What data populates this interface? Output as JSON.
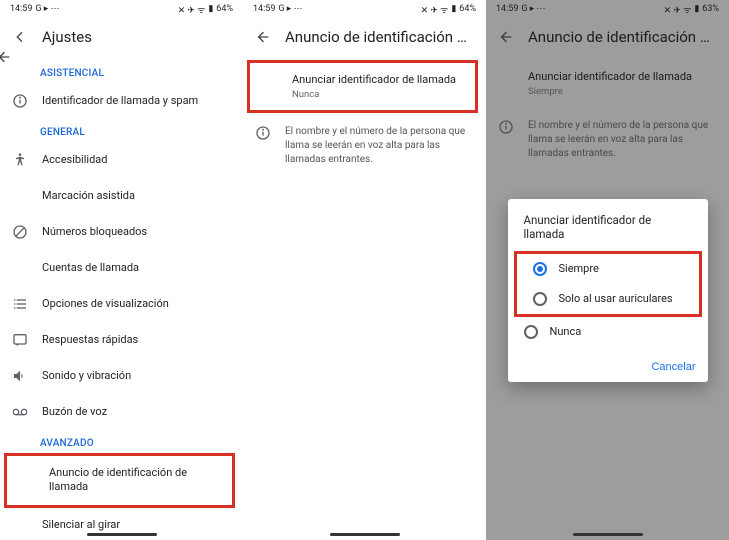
{
  "status": {
    "time": "14:59",
    "left_icons": "G ▸ ⋯",
    "right_icons": "✕ ✈ ᯤ",
    "battery_a": "64%",
    "battery_c": "63%"
  },
  "panel1": {
    "title": "Ajustes",
    "sections": {
      "asistencial": "ASISTENCIAL",
      "general": "GENERAL",
      "avanzado": "AVANZADO"
    },
    "items": {
      "caller_id_spam": "Identificador de llamada y spam",
      "accessibility": "Accesibilidad",
      "assisted_dialing": "Marcación asistida",
      "blocked_numbers": "Números bloqueados",
      "calling_accounts": "Cuentas de llamada",
      "display_options": "Opciones de visualización",
      "quick_responses": "Respuestas rápidas",
      "sounds_vibration": "Sonido y vibración",
      "voicemail": "Buzón de voz",
      "caller_id_announce": "Anuncio de identificación de llamada",
      "flip_silence": "Silenciar al girar"
    }
  },
  "panel2": {
    "title": "Anuncio de identificación de lla...",
    "setting_title": "Anunciar identificador de llamada",
    "setting_value": "Nunca",
    "info": "El nombre y el número de la persona que llama se leerán en voz alta para las llamadas entrantes."
  },
  "panel3": {
    "title": "Anuncio de identificación de lla...",
    "setting_title": "Anunciar identificador de llamada",
    "setting_value": "Siempre",
    "info": "El nombre y el número de la persona que llama se leerán en voz alta para las llamadas entrantes.",
    "dialog": {
      "title": "Anunciar identificador de llamada",
      "options": {
        "always": "Siempre",
        "headset": "Solo al usar auriculares",
        "never": "Nunca"
      },
      "cancel": "Cancelar"
    }
  }
}
